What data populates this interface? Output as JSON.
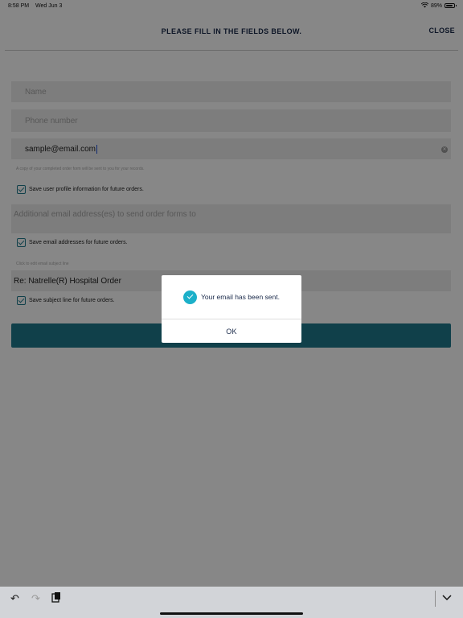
{
  "status_bar": {
    "time": "8:58 PM",
    "date": "Wed Jun 3",
    "battery": "89%"
  },
  "header": {
    "title": "PLEASE FILL IN THE FIELDS BELOW.",
    "close_label": "CLOSE"
  },
  "form": {
    "name_placeholder": "Name",
    "phone_placeholder": "Phone number",
    "email_value": "sample@email.com",
    "email_hint": "A copy of your completed order form will be sent to you for your records.",
    "save_profile_label": "Save user profile information for future orders.",
    "additional_email_placeholder": "Additional email address(es) to send order forms to",
    "save_emails_label": "Save email addresses for future orders.",
    "subject_hint": "Click to edit email subject line",
    "subject_value": "Re: Natrelle(R) Hospital Order",
    "save_subject_label": "Save subject line for future orders."
  },
  "dialog": {
    "message": "Your email has been sent.",
    "ok_label": "OK"
  },
  "keyboard_bar": {
    "undo_icon": "undo-icon",
    "redo_icon": "redo-icon",
    "paste_icon": "paste-icon",
    "dismiss_icon": "chevron-down-icon"
  },
  "colors": {
    "accent": "#1f7a8c",
    "dialog_icon": "#1cb0c9"
  }
}
